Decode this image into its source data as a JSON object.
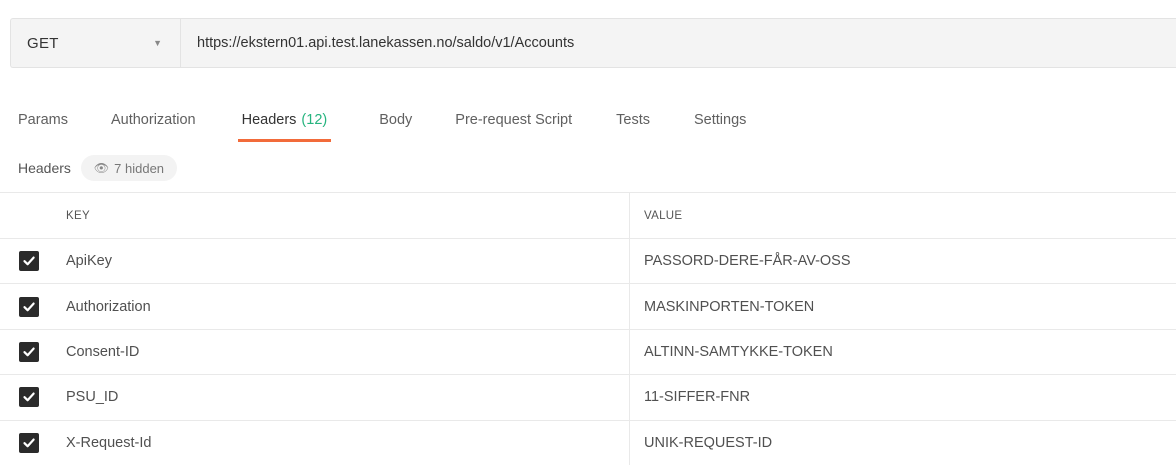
{
  "request": {
    "method": "GET",
    "url": "https://ekstern01.api.test.lanekassen.no/saldo/v1/Accounts"
  },
  "tabs": [
    {
      "label": "Params"
    },
    {
      "label": "Authorization"
    },
    {
      "label": "Headers",
      "count": "(12)",
      "active": true
    },
    {
      "label": "Body"
    },
    {
      "label": "Pre-request Script"
    },
    {
      "label": "Tests"
    },
    {
      "label": "Settings"
    }
  ],
  "headers_section": {
    "label": "Headers",
    "hidden_label": "7 hidden"
  },
  "table": {
    "columns": {
      "key": "KEY",
      "value": "VALUE"
    },
    "rows": [
      {
        "checked": true,
        "key": "ApiKey",
        "value": "PASSORD-DERE-FÅR-AV-OSS"
      },
      {
        "checked": true,
        "key": "Authorization",
        "value": "MASKINPORTEN-TOKEN"
      },
      {
        "checked": true,
        "key": "Consent-ID",
        "value": "ALTINN-SAMTYKKE-TOKEN"
      },
      {
        "checked": true,
        "key": "PSU_ID",
        "value": "11-SIFFER-FNR"
      },
      {
        "checked": true,
        "key": "X-Request-Id",
        "value": "UNIK-REQUEST-ID"
      }
    ]
  },
  "colors": {
    "active_tab_underline": "#f26b3a",
    "count_green": "#26b47f",
    "checkbox": "#2b2b2b"
  }
}
